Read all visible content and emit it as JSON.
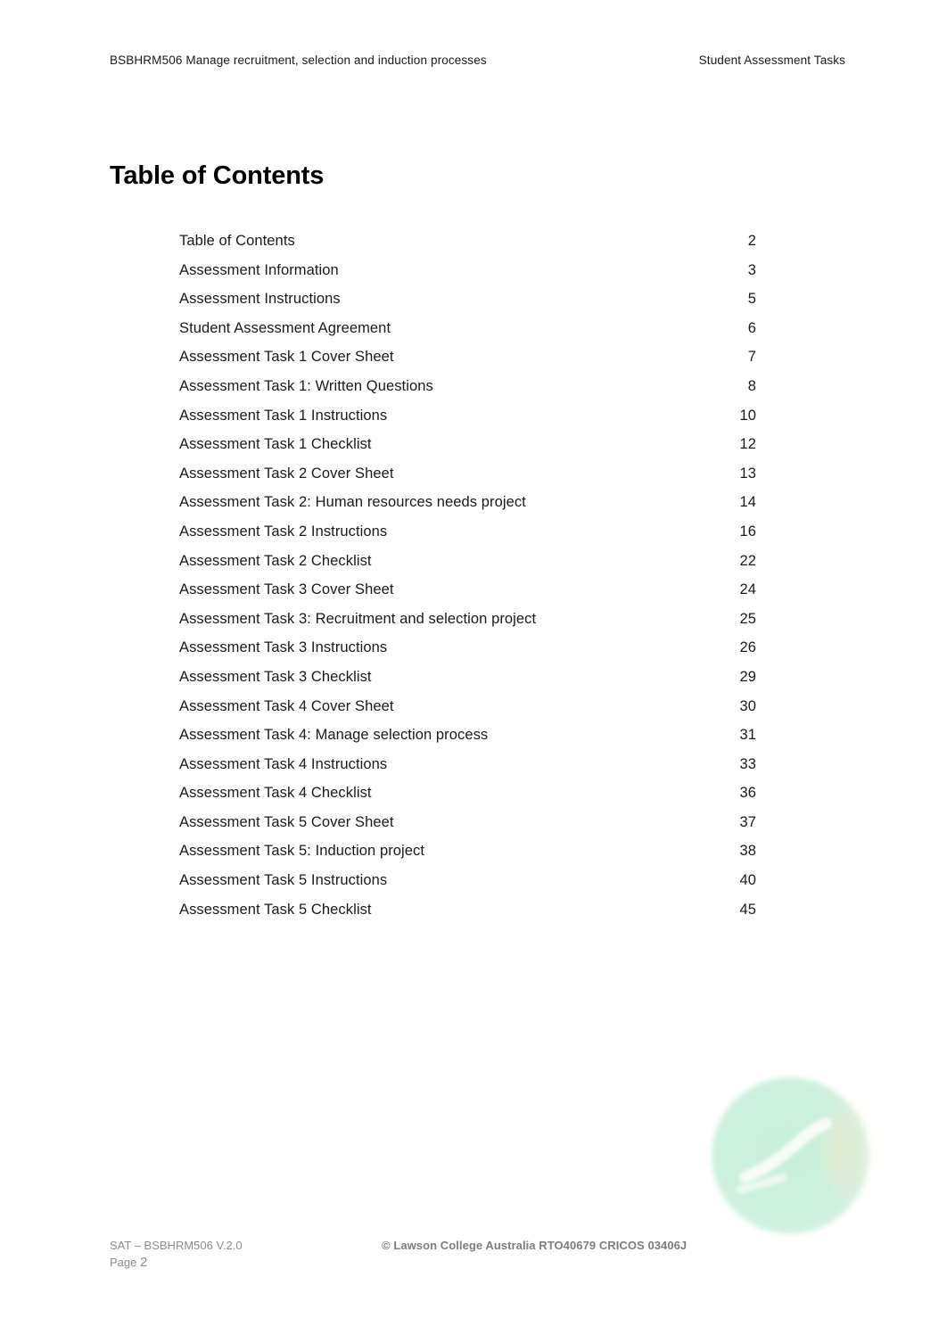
{
  "header": {
    "left": "BSBHRM506 Manage recruitment, selection and induction processes",
    "right": "Student Assessment Tasks"
  },
  "title": "Table of Contents",
  "toc": {
    "entries": [
      {
        "label": "Table of Contents",
        "page": "2"
      },
      {
        "label": "Assessment Information",
        "page": "3"
      },
      {
        "label": "Assessment Instructions",
        "page": "5"
      },
      {
        "label": "Student Assessment Agreement",
        "page": "6"
      },
      {
        "label": "Assessment Task 1 Cover Sheet",
        "page": "7"
      },
      {
        "label": "Assessment Task 1: Written Questions",
        "page": "8"
      },
      {
        "label": "Assessment Task 1 Instructions",
        "page": "10"
      },
      {
        "label": "Assessment Task 1 Checklist",
        "page": "12"
      },
      {
        "label": "Assessment Task 2 Cover Sheet",
        "page": "13"
      },
      {
        "label": "Assessment Task 2: Human resources needs project",
        "page": "14"
      },
      {
        "label": "Assessment Task 2 Instructions",
        "page": "16"
      },
      {
        "label": "Assessment Task 2 Checklist",
        "page": "22"
      },
      {
        "label": "Assessment Task 3 Cover Sheet",
        "page": "24"
      },
      {
        "label": "Assessment Task 3: Recruitment and selection project",
        "page": "25"
      },
      {
        "label": "Assessment Task 3 Instructions",
        "page": "26"
      },
      {
        "label": "Assessment Task 3 Checklist",
        "page": "29"
      },
      {
        "label": "Assessment Task 4 Cover Sheet",
        "page": "30"
      },
      {
        "label": "Assessment Task 4: Manage selection process",
        "page": "31"
      },
      {
        "label": "Assessment Task 4 Instructions",
        "page": "33"
      },
      {
        "label": "Assessment Task 4 Checklist",
        "page": "36"
      },
      {
        "label": "Assessment Task 5 Cover Sheet",
        "page": "37"
      },
      {
        "label": "Assessment Task 5: Induction project",
        "page": "38"
      },
      {
        "label": "Assessment Task 5 Instructions",
        "page": "40"
      },
      {
        "label": "Assessment Task 5 Checklist",
        "page": "45"
      }
    ]
  },
  "watermark": {
    "icon": "mint-circle-swoosh-logo",
    "color": "#cdf0de"
  },
  "footer": {
    "document_code": "SAT – BSBHRM506 V.2.0",
    "copyright": "© Lawson College Australia RTO40679 CRICOS 03406J",
    "page_label": "Page",
    "page_number": "2"
  }
}
